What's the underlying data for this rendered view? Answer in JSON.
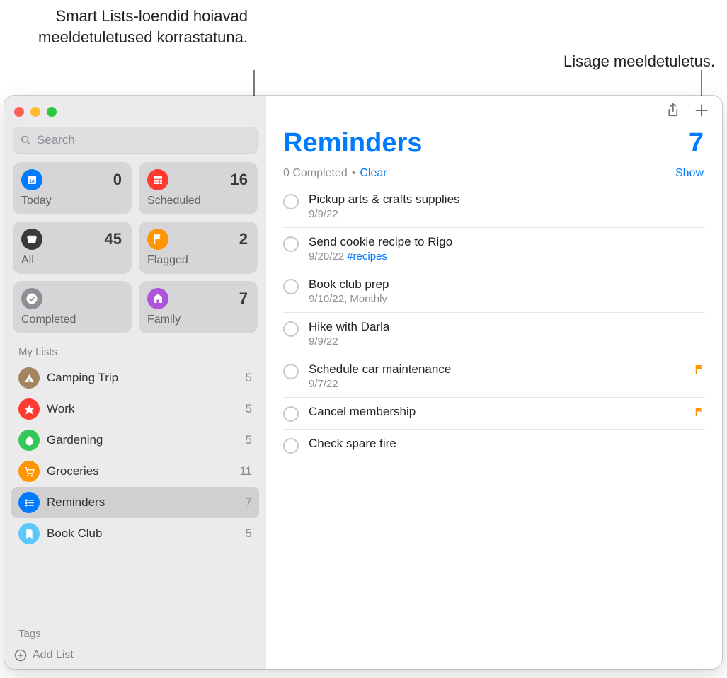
{
  "callouts": {
    "smart_lists": "Smart Lists-loendid hoiavad meeldetuletused korrastatuna.",
    "add_reminder": "Lisage meeldetuletus."
  },
  "sidebar": {
    "search_placeholder": "Search",
    "smart_cards": [
      {
        "id": "today",
        "label": "Today",
        "count": "0",
        "color": "#007aff",
        "iconColor": "#007aff"
      },
      {
        "id": "scheduled",
        "label": "Scheduled",
        "count": "16",
        "color": "#ff3b30",
        "iconColor": "#ff3b30"
      },
      {
        "id": "all",
        "label": "All",
        "count": "45",
        "color": "#3a3a3c",
        "iconColor": "#3a3a3c"
      },
      {
        "id": "flagged",
        "label": "Flagged",
        "count": "2",
        "color": "#ff9500",
        "iconColor": "#ff9500"
      },
      {
        "id": "completed",
        "label": "Completed",
        "count": "",
        "color": "#8e8e93",
        "iconColor": "#8e8e93"
      },
      {
        "id": "family",
        "label": "Family",
        "count": "7",
        "color": "#af52de",
        "iconColor": "#af52de"
      }
    ],
    "my_lists_header": "My Lists",
    "lists": [
      {
        "id": "camping",
        "name": "Camping Trip",
        "count": "5",
        "color": "#a2845e",
        "selected": false
      },
      {
        "id": "work",
        "name": "Work",
        "count": "5",
        "color": "#ff3b30",
        "selected": false
      },
      {
        "id": "gardening",
        "name": "Gardening",
        "count": "5",
        "color": "#34c759",
        "selected": false
      },
      {
        "id": "groceries",
        "name": "Groceries",
        "count": "11",
        "color": "#ff9500",
        "selected": false
      },
      {
        "id": "reminders",
        "name": "Reminders",
        "count": "7",
        "color": "#007aff",
        "selected": true
      },
      {
        "id": "bookclub",
        "name": "Book Club",
        "count": "5",
        "color": "#5ac8fa",
        "selected": false
      }
    ],
    "tags_header": "Tags",
    "add_list_label": "Add List"
  },
  "main": {
    "title": "Reminders",
    "count": "7",
    "completed_text": "0 Completed",
    "dot": "•",
    "clear_label": "Clear",
    "show_label": "Show",
    "items": [
      {
        "title": "Pickup arts & crafts supplies",
        "meta": "9/9/22",
        "tag": "",
        "flagged": false
      },
      {
        "title": "Send cookie recipe to Rigo",
        "meta": "9/20/22",
        "tag": "#recipes",
        "flagged": false
      },
      {
        "title": "Book club prep",
        "meta": "9/10/22, Monthly",
        "tag": "",
        "flagged": false
      },
      {
        "title": "Hike with Darla",
        "meta": "9/9/22",
        "tag": "",
        "flagged": false
      },
      {
        "title": "Schedule car maintenance",
        "meta": "9/7/22",
        "tag": "",
        "flagged": true
      },
      {
        "title": "Cancel membership",
        "meta": "",
        "tag": "",
        "flagged": true
      },
      {
        "title": "Check spare tire",
        "meta": "",
        "tag": "",
        "flagged": false
      }
    ]
  }
}
